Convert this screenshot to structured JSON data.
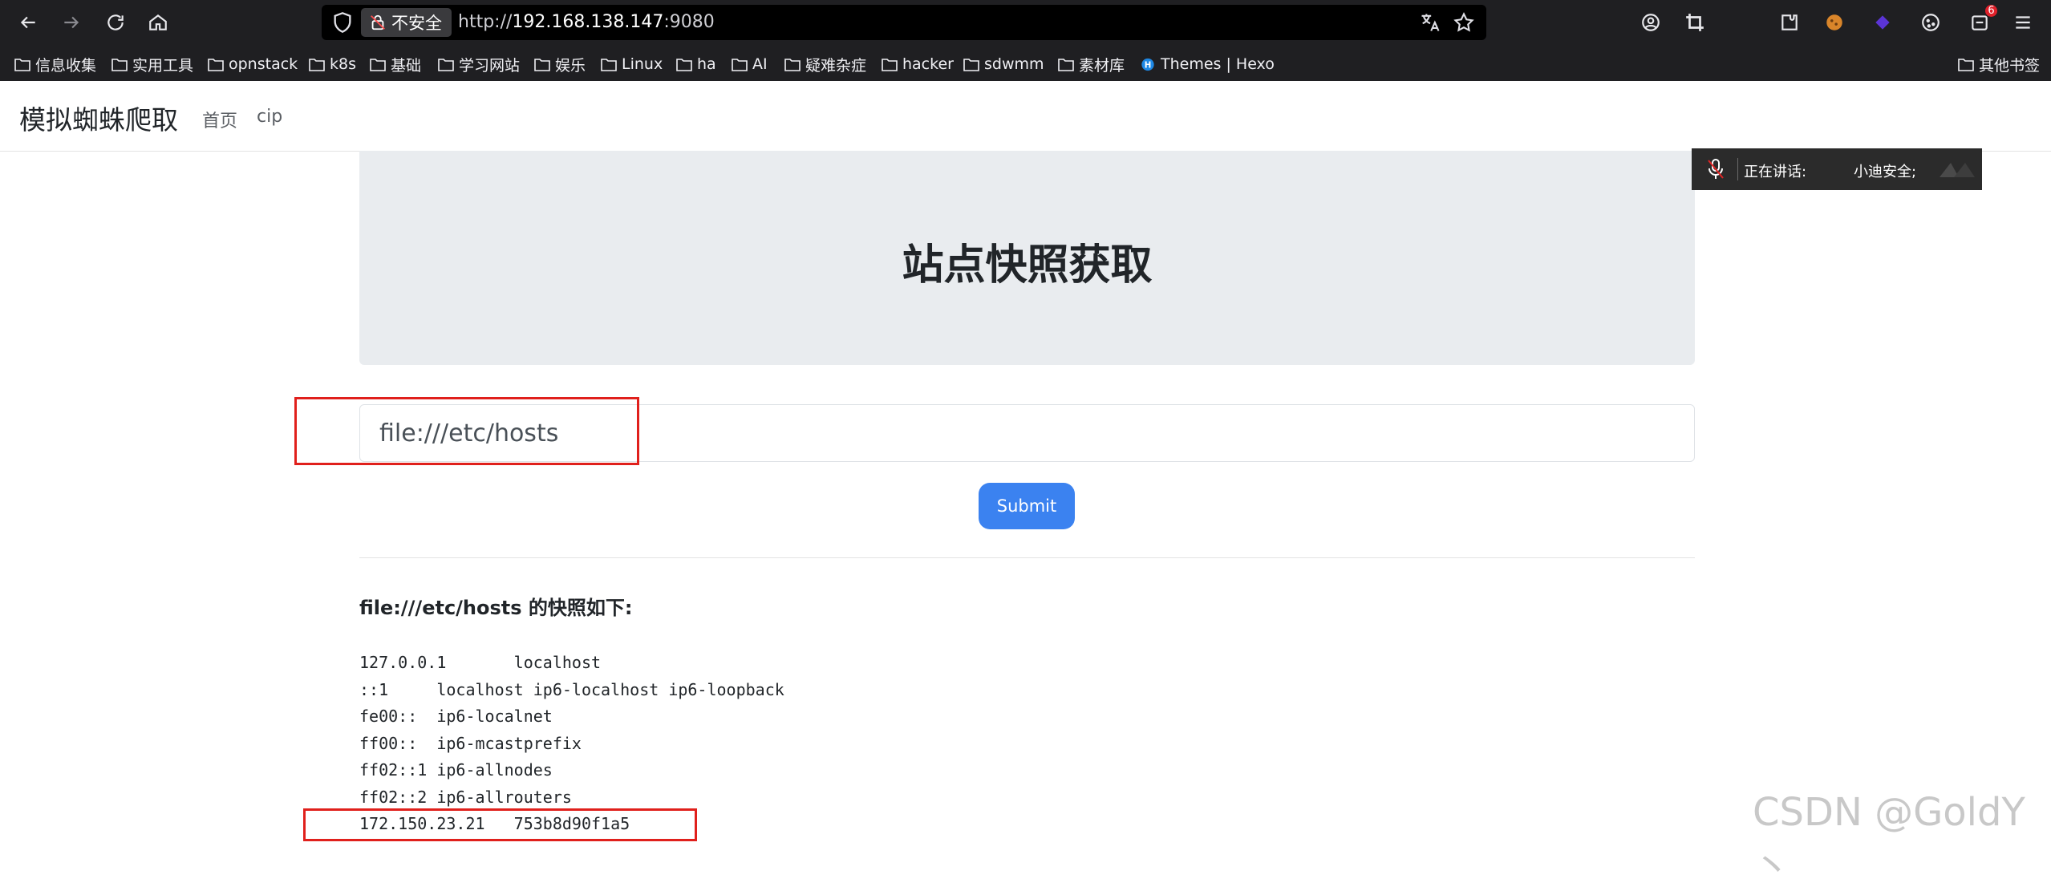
{
  "browser": {
    "insecure_label": "不安全",
    "url_scheme": "http://",
    "url_host": "192.168.138.147",
    "url_port": ":9080",
    "extension_badge": "6",
    "bookmarks": [
      "信息收集",
      "实用工具",
      "opnstack",
      "k8s",
      "基础",
      "学习网站",
      "娱乐",
      "Linux",
      "ha",
      "AI",
      "疑难杂症",
      "hacker",
      "sdwmm",
      "素材库",
      "Themes | Hexo"
    ],
    "other_bookmarks": "其他书签"
  },
  "site": {
    "brand": "模拟蜘蛛爬取",
    "nav": [
      "首页",
      "cip"
    ]
  },
  "speaking": {
    "label": "正在讲话:",
    "name": "小迪安全;"
  },
  "main": {
    "title": "站点快照获取",
    "input_value": "file:///etc/hosts",
    "submit_label": "Submit",
    "result_heading": "file:///etc/hosts 的快照如下:",
    "hosts": [
      "127.0.0.1\tlocalhost",
      "::1\tlocalhost ip6-localhost ip6-loopback",
      "fe00::\tip6-localnet",
      "ff00::\tip6-mcastprefix",
      "ff02::1\tip6-allnodes",
      "ff02::2\tip6-allrouters",
      "172.150.23.21\t753b8d90f1a5"
    ]
  },
  "watermark": "CSDN @GoldY丶"
}
